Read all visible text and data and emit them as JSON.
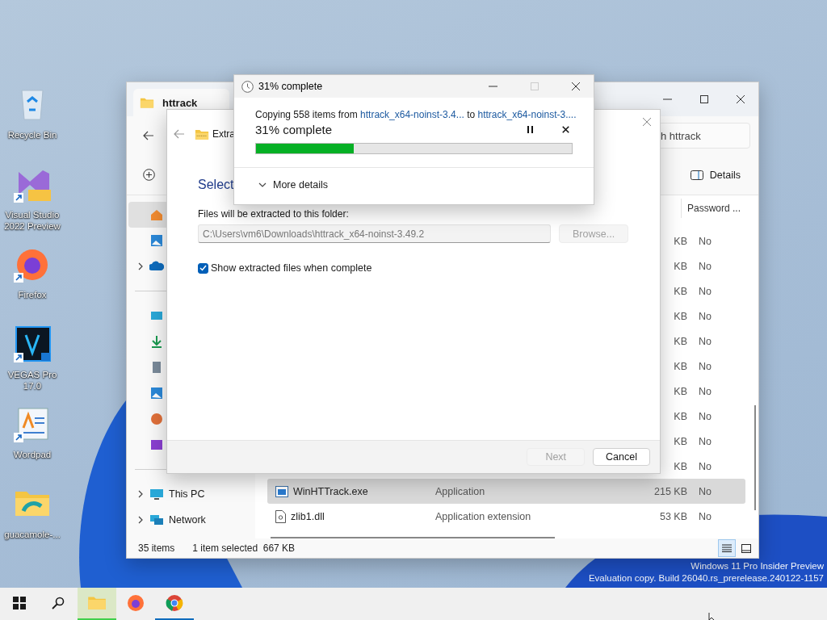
{
  "desktop": {
    "icons": [
      {
        "kind": "bin",
        "label": "Recycle Bin",
        "shortcut": false
      },
      {
        "kind": "vs",
        "label": "Visual Studio 2022 Preview",
        "shortcut": true
      },
      {
        "kind": "firefox",
        "label": "Firefox",
        "shortcut": true
      },
      {
        "kind": "vegas",
        "label": "VEGAS Pro 17.0",
        "shortcut": true
      },
      {
        "kind": "wordpad",
        "label": "Wordpad",
        "shortcut": true
      },
      {
        "kind": "folder",
        "label": "guacamole-...",
        "shortcut": false
      }
    ],
    "watermark": [
      "Windows 11 Pro Insider Preview",
      "Evaluation copy. Build 26040.rs_prerelease.240122-1157"
    ]
  },
  "explorer": {
    "tab_title": "httrack",
    "search_placeholder": "h httrack",
    "details_label": "Details",
    "nav_items": [
      {
        "kind": "home",
        "expandable": false,
        "selected": true
      },
      {
        "kind": "gallery",
        "expandable": false,
        "selected": false
      },
      {
        "kind": "cloud",
        "expandable": true,
        "selected": false
      },
      {
        "kind": "desktop",
        "expandable": false,
        "selected": false
      },
      {
        "kind": "downloads",
        "expandable": false,
        "selected": false
      },
      {
        "kind": "documents",
        "expandable": false,
        "selected": false
      },
      {
        "kind": "pictures",
        "expandable": false,
        "selected": false
      },
      {
        "kind": "music",
        "expandable": false,
        "selected": false
      },
      {
        "kind": "videos",
        "expandable": false,
        "selected": false
      },
      {
        "kind": "pc",
        "label": "This PC",
        "expandable": true,
        "selected": false
      },
      {
        "kind": "network",
        "label": "Network",
        "expandable": true,
        "selected": false
      }
    ],
    "column_header": "Password ...",
    "partial_rows": [
      {
        "size": "KB",
        "password": "No"
      },
      {
        "size": "KB",
        "password": "No"
      },
      {
        "size": "KB",
        "password": "No"
      },
      {
        "size": "KB",
        "password": "No"
      },
      {
        "size": "KB",
        "password": "No"
      },
      {
        "size": "KB",
        "password": "No"
      },
      {
        "size": "KB",
        "password": "No"
      },
      {
        "size": "KB",
        "password": "No"
      },
      {
        "size": "KB",
        "password": "No"
      },
      {
        "size": "KB",
        "password": "No"
      }
    ],
    "rows": [
      {
        "kind": "exe",
        "name": "WinHTTrack.exe",
        "type": "Application",
        "size": "215 KB",
        "password": "No",
        "selected": true
      },
      {
        "kind": "dll",
        "name": "zlib1.dll",
        "type": "Application extension",
        "size": "53 KB",
        "password": "No",
        "selected": false
      }
    ],
    "status_count": "35 items",
    "status_selection": "1 item selected  667 KB",
    "views": [
      {
        "kind": "details",
        "selected": true
      },
      {
        "kind": "tiles",
        "selected": false
      }
    ]
  },
  "extract": {
    "title": "Extra",
    "heading": "Select",
    "field_label": "Files will be extracted to this folder:",
    "path": "C:\\Users\\vm6\\Downloads\\httrack_x64-noinst-3.49.2",
    "browse": {
      "label": "Browse...",
      "disabled": true
    },
    "show_files": {
      "label": "Show extracted files when complete",
      "checked": true
    },
    "next": {
      "label": "Next",
      "disabled": true
    },
    "cancel": "Cancel"
  },
  "copy": {
    "title": "31% complete",
    "copying": "Copying 558 items from ",
    "source": "httrack_x64-noinst-3.4...",
    "to": " to ",
    "destination": "httrack_x64-noinst-3....",
    "status": "31% complete",
    "level": 0.31,
    "more": "More details"
  },
  "taskbar": [
    {
      "kind": "start",
      "selected": false,
      "running": false
    },
    {
      "kind": "search",
      "selected": false,
      "running": false
    },
    {
      "kind": "explorer",
      "selected": true,
      "running": true
    },
    {
      "kind": "firefox",
      "selected": false,
      "running": false
    },
    {
      "kind": "chrome",
      "selected": false,
      "running": true
    }
  ]
}
